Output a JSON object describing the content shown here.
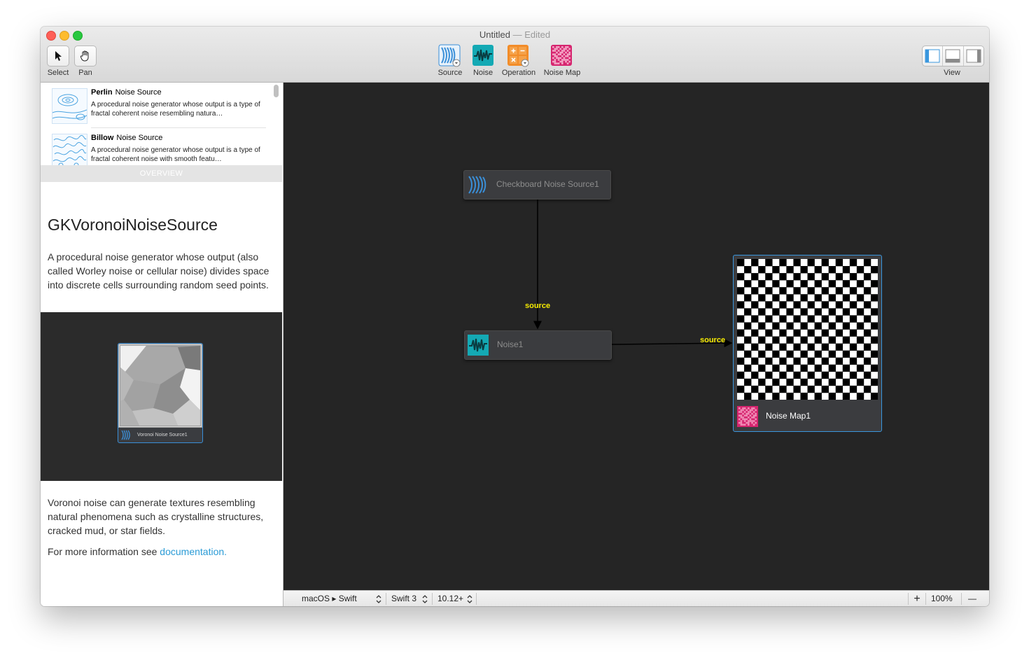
{
  "window": {
    "title": "Untitled",
    "status": "— Edited"
  },
  "toolbar": {
    "select_label": "Select",
    "pan_label": "Pan",
    "source_label": "Source",
    "noise_label": "Noise",
    "operation_label": "Operation",
    "noise_map_label": "Noise Map",
    "view_label": "View"
  },
  "library": {
    "items": [
      {
        "name": "Perlin",
        "category": "Noise Source",
        "description": "A procedural noise generator whose output is a type of fractal coherent noise resembling natura…"
      },
      {
        "name": "Billow",
        "category": "Noise Source",
        "description": "A procedural noise generator whose output is a type of fractal coherent noise with smooth featu…"
      }
    ]
  },
  "overview": {
    "header": "OVERVIEW",
    "title": "GKVoronoiNoiseSource",
    "summary": "A procedural noise generator whose output (also called Worley noise or cellular noise) divides space into discrete cells surrounding random seed points.",
    "preview_node_label": "Voronoi Noise Source1",
    "details": "Voronoi noise can generate textures resembling natural phenomena such as crystalline structures, cracked mud, or star fields.",
    "more_info_prefix": "For more information see ",
    "more_info_link": "documentation."
  },
  "canvas": {
    "nodes": [
      {
        "id": "checkboard",
        "label": "Checkboard Noise Source1",
        "icon": "source-icon"
      },
      {
        "id": "noise1",
        "label": "Noise1",
        "icon": "noise-icon"
      },
      {
        "id": "noisemap1",
        "label": "Noise Map1",
        "icon": "noise-map-icon"
      }
    ],
    "connection_labels": [
      "source",
      "source"
    ]
  },
  "statusbar": {
    "platform": "macOS ▸ Swift",
    "swift_version": "Swift 3",
    "os_version": "10.12+",
    "zoom_in": "+",
    "zoom": "100%",
    "zoom_out": "—"
  },
  "colors": {
    "accent": "#3a97de",
    "source_icon": "#3a8fd8",
    "noise_icon": "#14a9b4",
    "operation_icon": "#f28c28",
    "noise_map_icon": "#d6256f",
    "port_label": "#f7ec00"
  }
}
